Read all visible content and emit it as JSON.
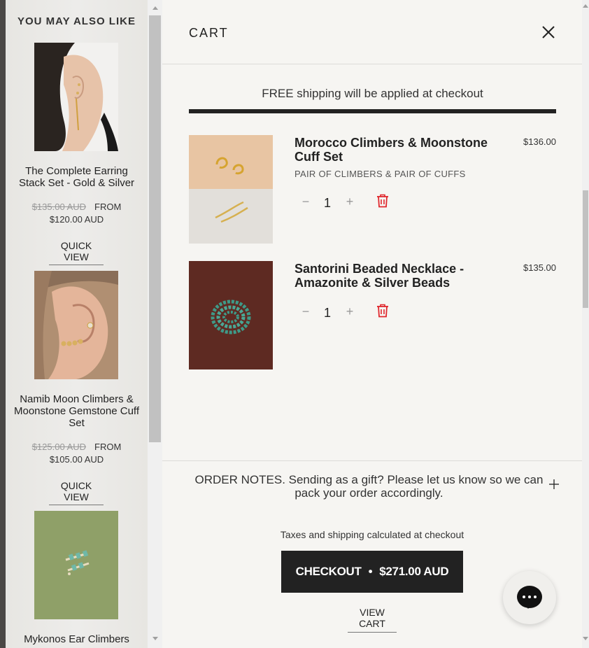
{
  "recommendations": {
    "title": "YOU MAY ALSO LIKE",
    "items": [
      {
        "name": "The Complete Earring Stack Set - Gold & Silver",
        "old_price": "$135.00 AUD",
        "from_label": "FROM",
        "price": "$120.00 AUD",
        "quick_view": "QUICK VIEW"
      },
      {
        "name": "Namib Moon Climbers & Moonstone Gemstone Cuff Set",
        "old_price": "$125.00 AUD",
        "from_label": "FROM",
        "price": "$105.00 AUD",
        "quick_view": "QUICK VIEW"
      },
      {
        "name": "Mykonos Ear Climbers"
      }
    ]
  },
  "cart": {
    "title": "CART",
    "free_shipping": "FREE shipping will be applied at checkout",
    "shipping_progress": 1.0,
    "items": [
      {
        "name": "Morocco Climbers & Moonstone Cuff Set",
        "price": "$136.00",
        "variant": "PAIR OF CLIMBERS & PAIR OF CUFFS",
        "qty": "1"
      },
      {
        "name": "Santorini Beaded Necklace - Amazonite & Silver Beads",
        "price": "$135.00",
        "qty": "1"
      }
    ],
    "order_notes": "ORDER NOTES. Sending as a gift? Please let us know so we can pack your order accordingly.",
    "taxes_note": "Taxes and shipping calculated at checkout",
    "checkout_label": "CHECKOUT",
    "checkout_separator": "•",
    "checkout_total": "$271.00 AUD",
    "view_cart": "VIEW CART"
  },
  "colors": {
    "accent": "#222222",
    "delete": "#e0262c",
    "background": "#f6f5f2"
  },
  "icons": {
    "close": "close-icon",
    "delete": "trash-icon",
    "notes_expand": "plus-icon",
    "chat": "chat-icon"
  }
}
